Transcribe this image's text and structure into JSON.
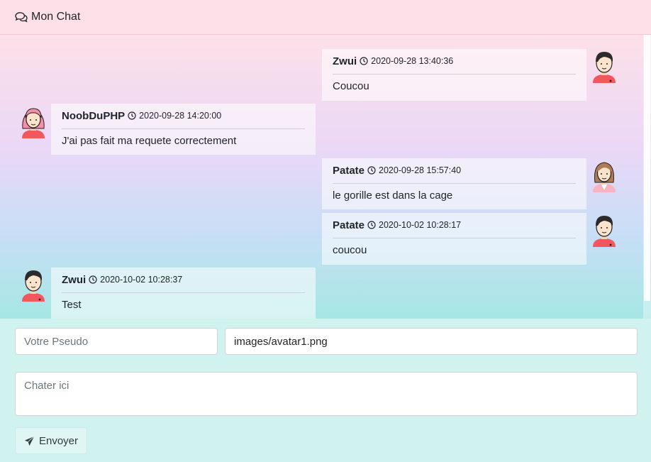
{
  "header": {
    "title": "Mon Chat",
    "icon": "comments-icon"
  },
  "messages": [
    {
      "author": "Zwui",
      "date": "2020-09-28 13:40:36",
      "text": "Coucou",
      "side": "right",
      "avatar": "avatar-boy-icon"
    },
    {
      "author": "NoobDuPHP",
      "date": "2020-09-28 14:20:00",
      "text": "J'ai pas fait ma requete correctement",
      "side": "left",
      "avatar": "avatar-pink-girl-icon"
    },
    {
      "author": "Patate",
      "date": "2020-09-28 15:57:40",
      "text": "le gorille est dans la cage",
      "side": "right",
      "avatar": "avatar-girl-icon"
    },
    {
      "author": "Patate",
      "date": "2020-10-02 10:28:17",
      "text": "coucou",
      "side": "right",
      "avatar": "avatar-boy-icon"
    },
    {
      "author": "Zwui",
      "date": "2020-10-02 10:28:37",
      "text": "Test",
      "side": "left",
      "avatar": "avatar-boy-icon"
    }
  ],
  "form": {
    "pseudo_placeholder": "Votre Pseudo",
    "pseudo_value": "",
    "avatar_value": "images/avatar1.png",
    "message_placeholder": "Chater ici",
    "send_label": "Envoyer"
  },
  "colors": {
    "header_bg": "#fde0e8",
    "form_bg": "#d1f3f0",
    "message_bg": "#ffffff"
  }
}
